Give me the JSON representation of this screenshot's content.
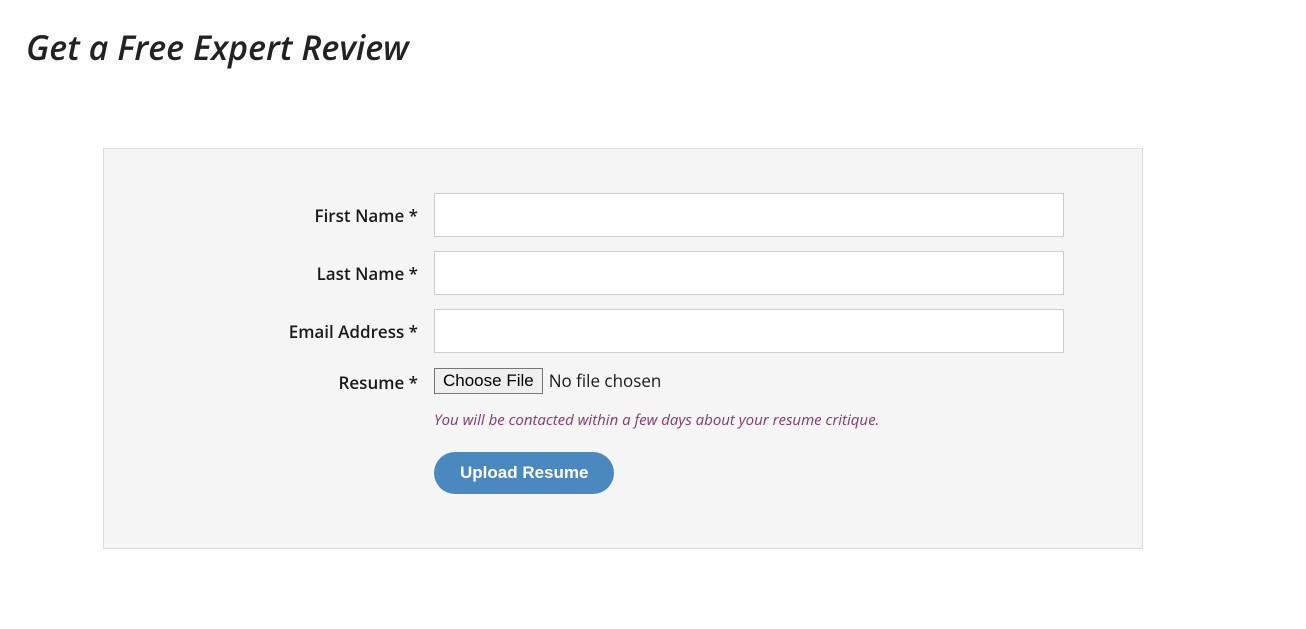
{
  "page": {
    "title": "Get a Free Expert Review"
  },
  "form": {
    "firstName": {
      "label": "First Name *",
      "value": ""
    },
    "lastName": {
      "label": "Last Name *",
      "value": ""
    },
    "email": {
      "label": "Email Address *",
      "value": ""
    },
    "resume": {
      "label": "Resume *",
      "chooseButton": "Choose File",
      "fileStatus": "No file chosen"
    },
    "hint": "You will be contacted within a few days about your resume critique.",
    "submitLabel": "Upload Resume"
  }
}
